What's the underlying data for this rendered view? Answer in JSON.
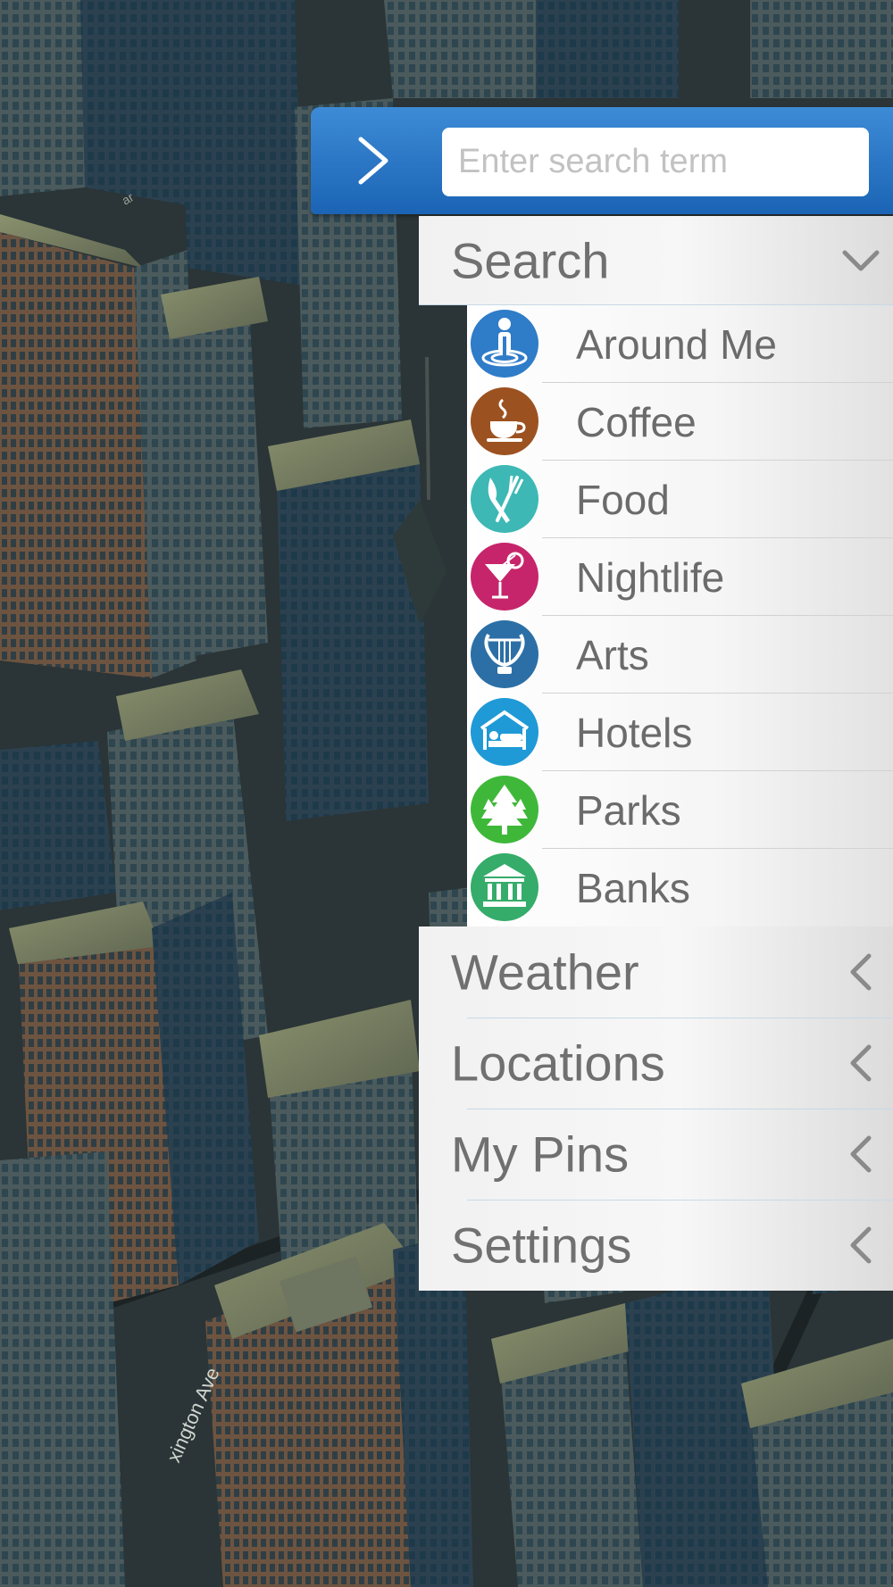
{
  "search": {
    "placeholder": "Enter search term"
  },
  "menu": {
    "search_section": "Search",
    "categories": [
      {
        "label": "Around Me",
        "icon": "around-me-icon",
        "color": "#2f7cc8"
      },
      {
        "label": "Coffee",
        "icon": "coffee-cup-icon",
        "color": "#9c5220"
      },
      {
        "label": "Food",
        "icon": "knife-fork-icon",
        "color": "#3db8b5"
      },
      {
        "label": "Nightlife",
        "icon": "cocktail-icon",
        "color": "#c7256b"
      },
      {
        "label": "Arts",
        "icon": "lyre-icon",
        "color": "#2c6fa6"
      },
      {
        "label": "Hotels",
        "icon": "hotel-bed-icon",
        "color": "#1f9ad6"
      },
      {
        "label": "Parks",
        "icon": "trees-icon",
        "color": "#3fb83a"
      },
      {
        "label": "Banks",
        "icon": "bank-building-icon",
        "color": "#35ac6a"
      }
    ],
    "sections": [
      {
        "label": "Weather"
      },
      {
        "label": "Locations"
      },
      {
        "label": "My Pins"
      },
      {
        "label": "Settings"
      }
    ]
  },
  "map": {
    "street_label_1": "xington Ave",
    "street_label_2": "ar"
  },
  "colors": {
    "topbar_top": "#3d8bd6",
    "topbar_bottom": "#1b64b5",
    "menu_text": "#707070"
  }
}
